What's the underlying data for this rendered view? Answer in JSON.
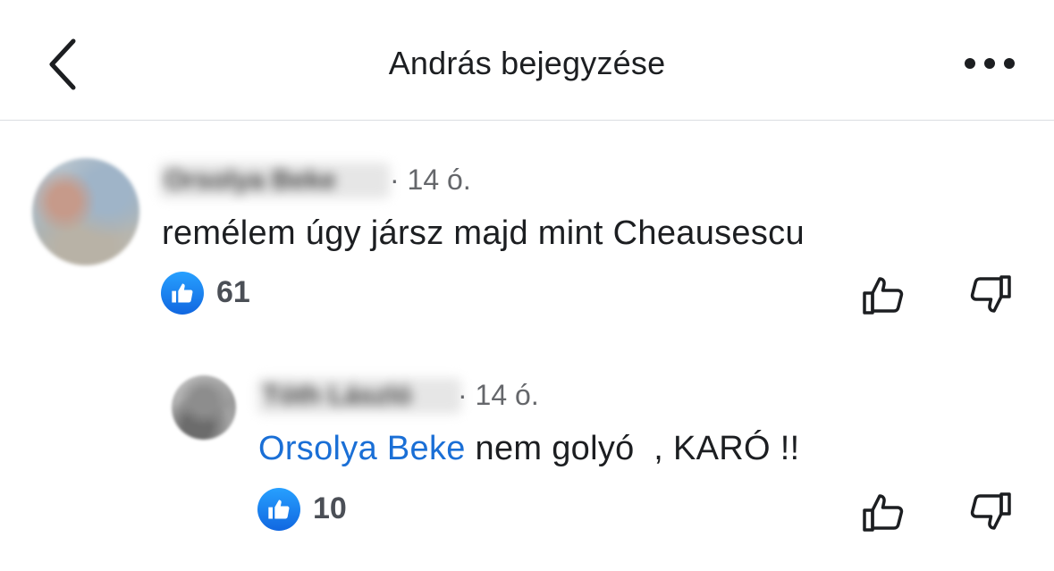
{
  "header": {
    "title": "András bejegyzése",
    "back_icon": "chevron-left-icon",
    "more_icon": "ellipsis-icon"
  },
  "comments": [
    {
      "author": "Orsolya Beke",
      "time": "· 14 ó.",
      "text": "remélem úgy jársz majd mint Cheausescu",
      "likes": "61"
    }
  ],
  "reply": {
    "author": "Tóth László",
    "time": "· 14 ó.",
    "mention": "Orsolya Beke",
    "text": " nem golyó  , KARÓ !!",
    "likes": "10"
  },
  "colors": {
    "accent": "#1a6fd6",
    "like_badge": "#1877f2",
    "muted": "#65676b"
  }
}
